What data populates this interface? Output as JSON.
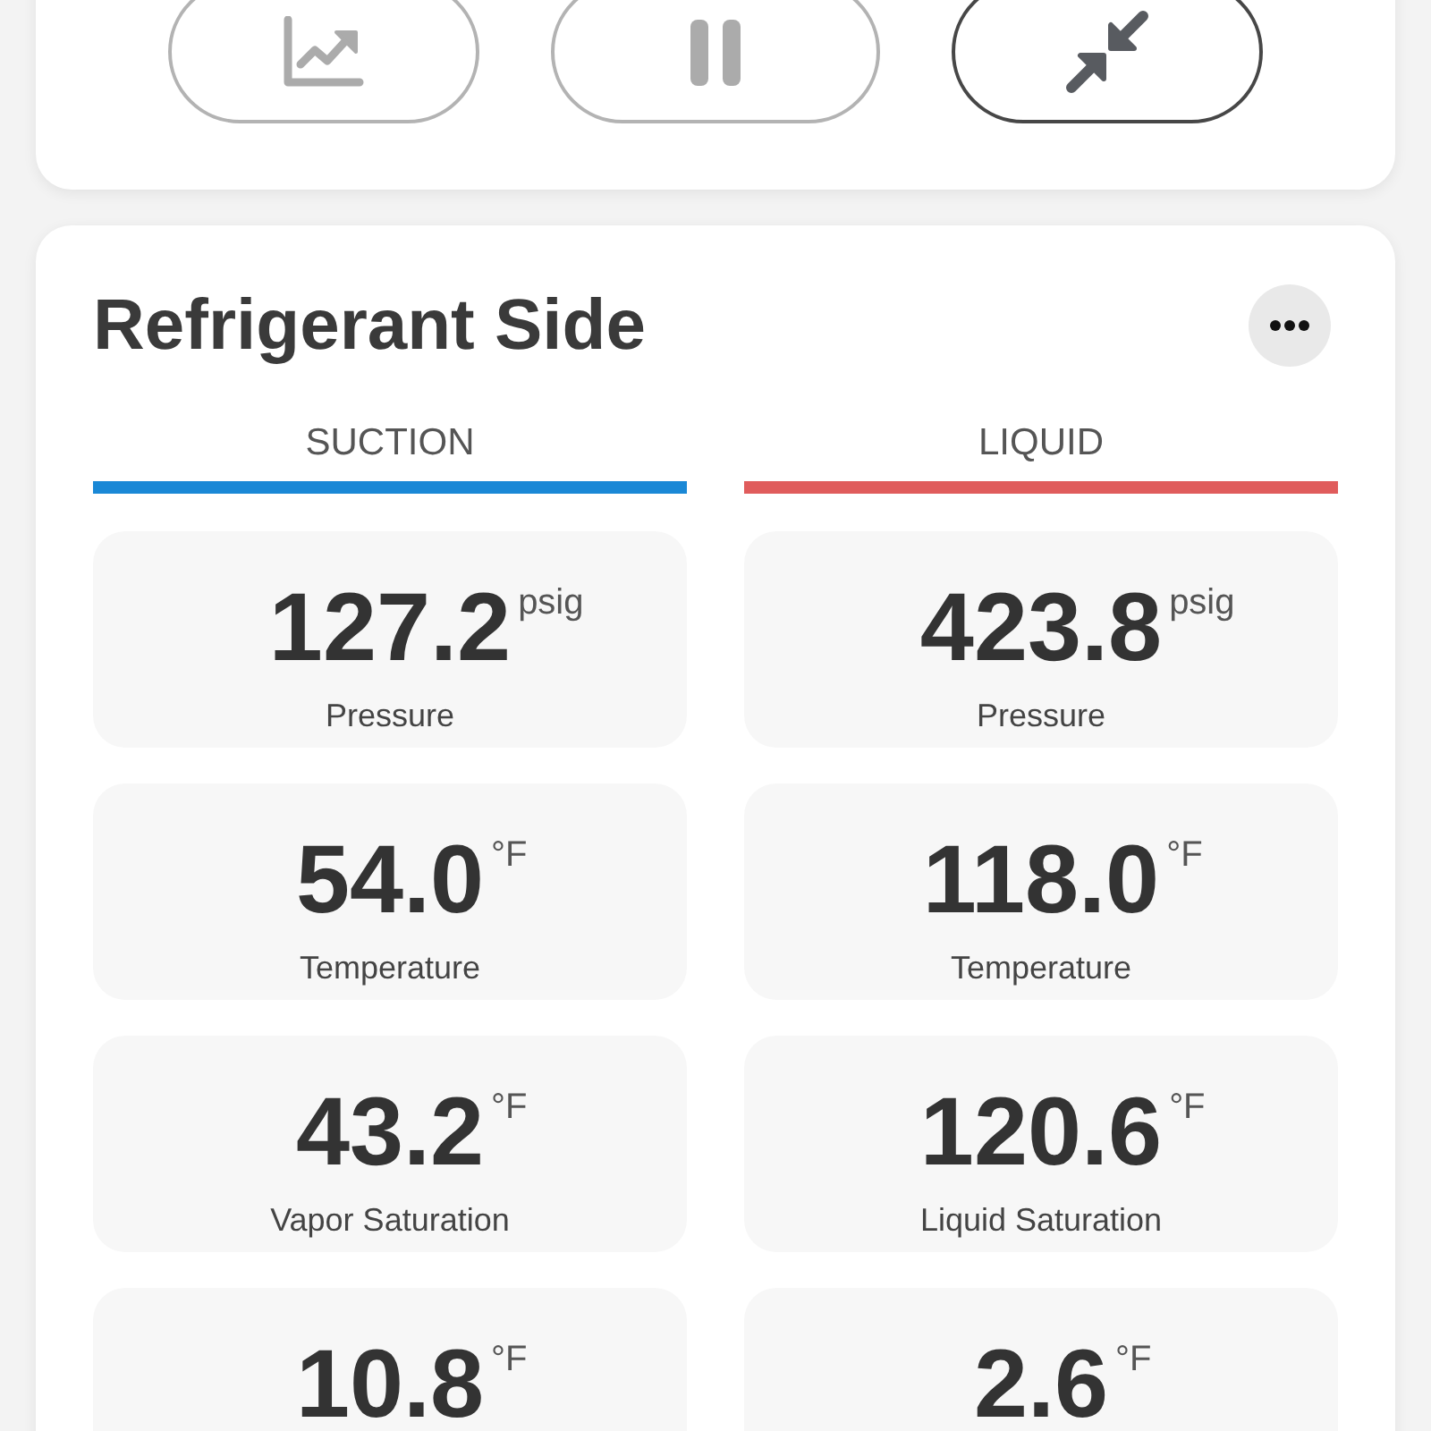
{
  "toolbar": {
    "buttons": [
      {
        "kind": "chart",
        "disabled": true
      },
      {
        "kind": "pause",
        "disabled": true
      },
      {
        "kind": "collapse",
        "disabled": false
      }
    ]
  },
  "panel": {
    "title": "Refrigerant Side",
    "columns": [
      {
        "title": "SUCTION",
        "color": "#1a88d6",
        "readings": [
          {
            "value": "127.2",
            "unit": "psig",
            "label": "Pressure"
          },
          {
            "value": "54.0",
            "unit": "°F",
            "label": "Temperature"
          },
          {
            "value": "43.2",
            "unit": "°F",
            "label": "Vapor Saturation"
          },
          {
            "value": "10.8",
            "unit": "°F"
          }
        ]
      },
      {
        "title": "LIQUID",
        "color": "#e05c5c",
        "readings": [
          {
            "value": "423.8",
            "unit": "psig",
            "label": "Pressure"
          },
          {
            "value": "118.0",
            "unit": "°F",
            "label": "Temperature"
          },
          {
            "value": "120.6",
            "unit": "°F",
            "label": "Liquid Saturation"
          },
          {
            "value": "2.6",
            "unit": "°F"
          }
        ]
      }
    ]
  }
}
